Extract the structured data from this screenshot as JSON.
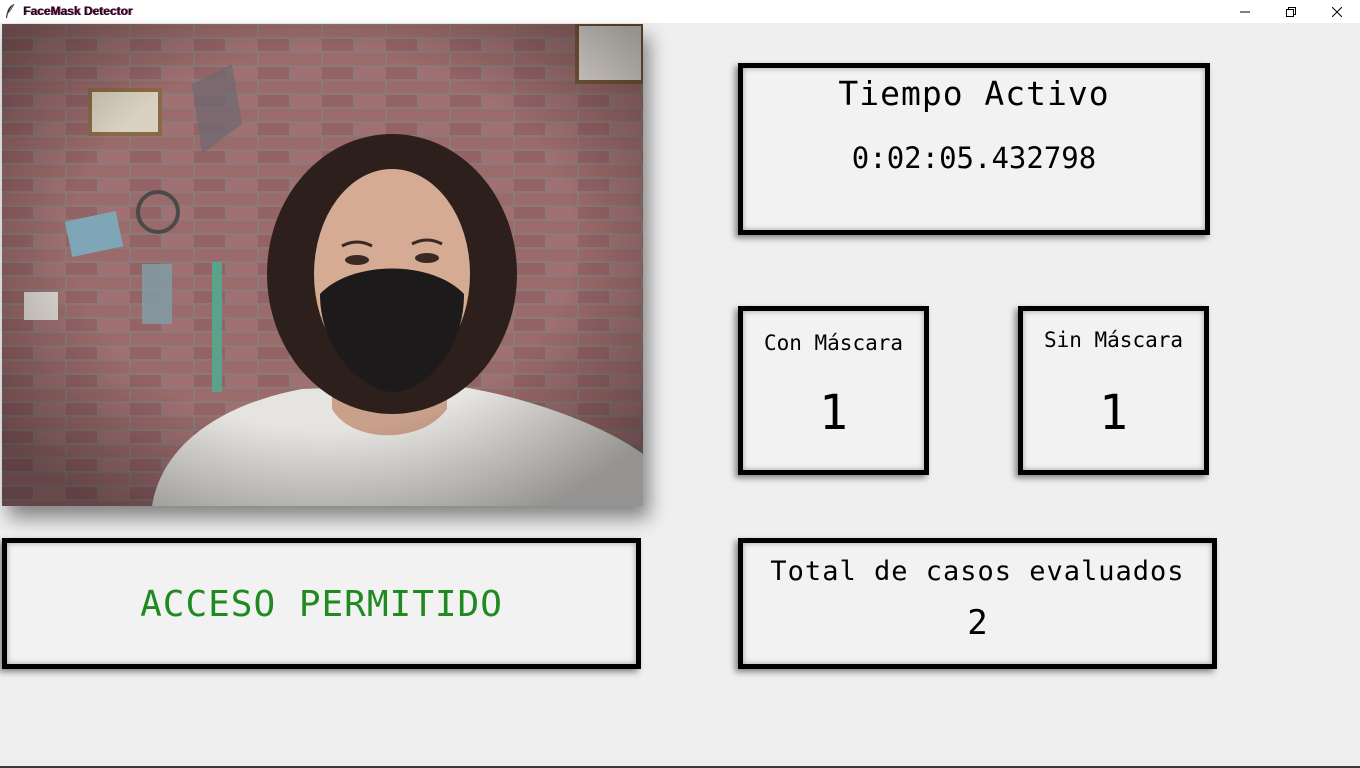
{
  "window": {
    "title": "FaceMask Detector",
    "icon": "feather-icon",
    "controls": [
      "minimize-icon",
      "restore-icon",
      "close-icon"
    ]
  },
  "camera": {
    "description": "webcam-feed"
  },
  "tiempo": {
    "label": "Tiempo Activo",
    "value": "0:02:05.432798"
  },
  "con_mascara": {
    "label": "Con Máscara",
    "value": "1"
  },
  "sin_mascara": {
    "label": "Sin Máscara",
    "value": "1"
  },
  "total": {
    "label": "Total de casos evaluados",
    "value": "2"
  },
  "status": {
    "value": "ACCESO PERMITIDO",
    "color": "#1f8a1f"
  }
}
